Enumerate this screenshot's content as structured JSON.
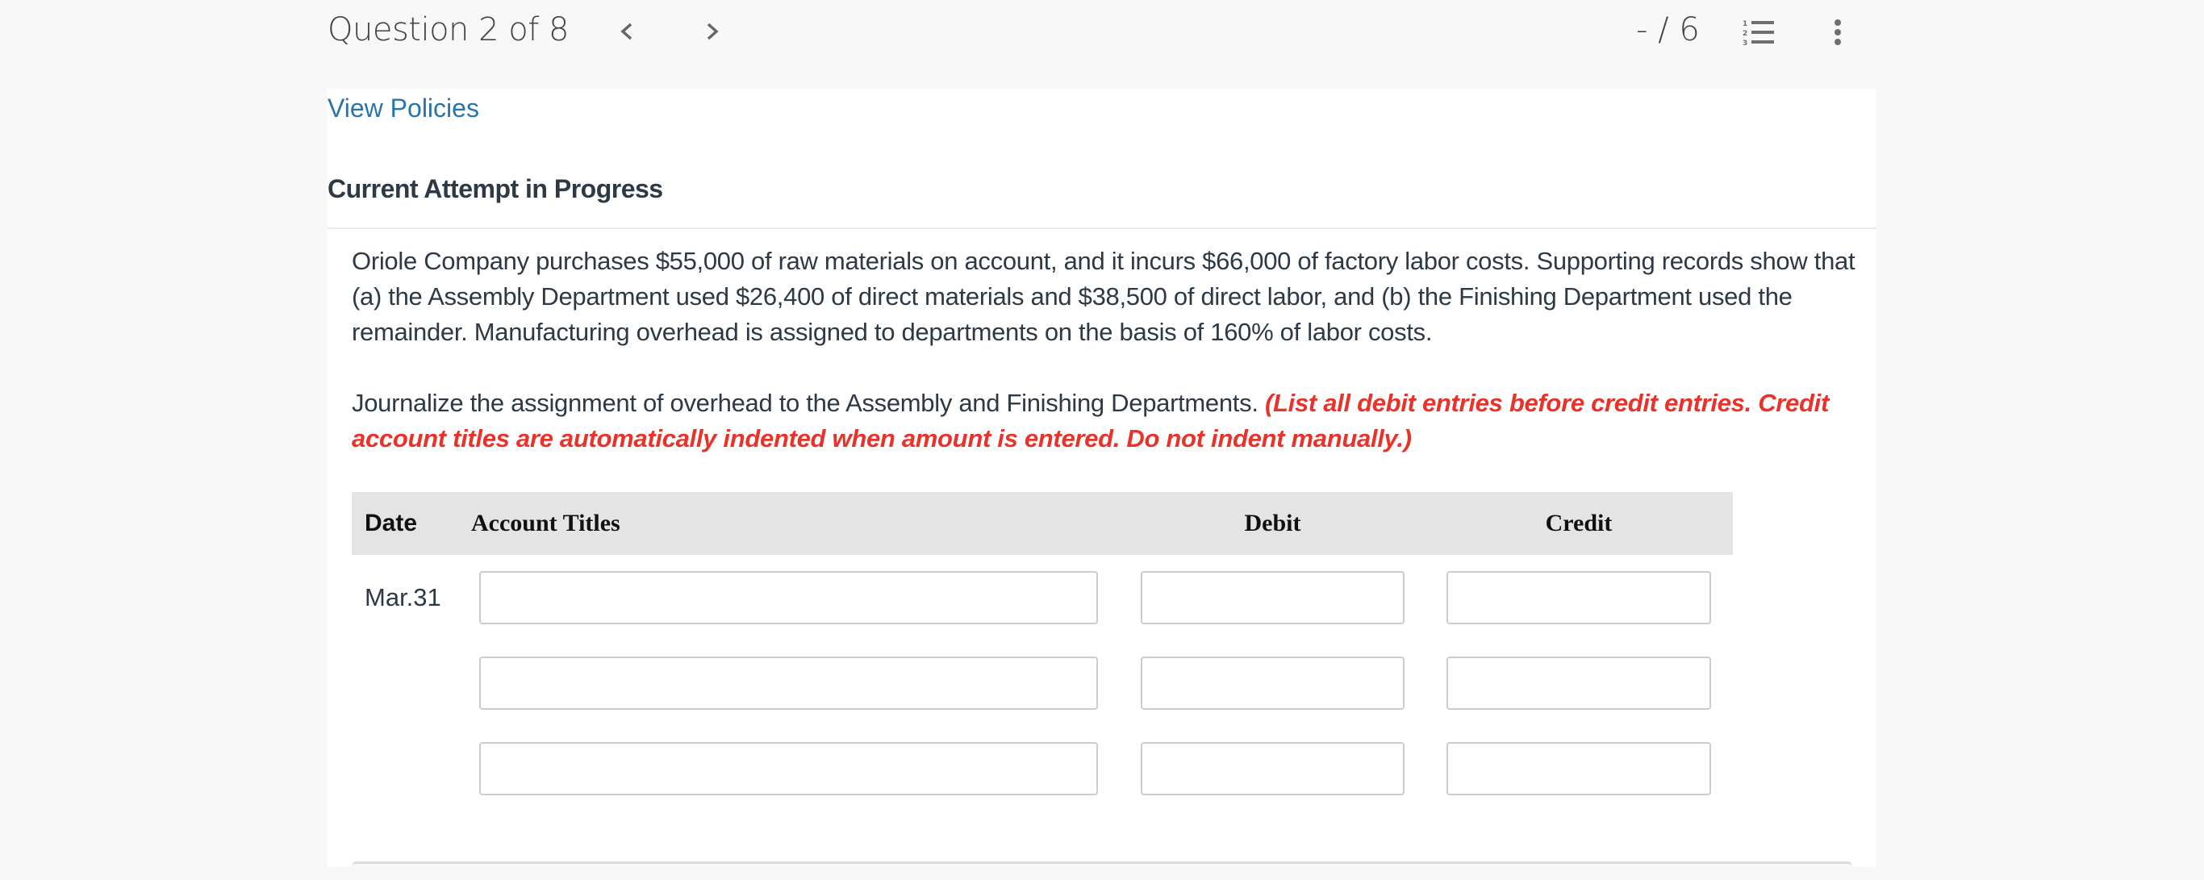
{
  "header": {
    "question_label": "Question 2 of 8",
    "prev_icon": "chevron-left-icon",
    "next_icon": "chevron-right-icon",
    "score": "- / 6",
    "list_icon": "numbered-list-icon",
    "more_icon": "more-vertical-icon"
  },
  "links": {
    "view_policies": "View Policies"
  },
  "attempt_label": "Current Attempt in Progress",
  "question": {
    "text": "Oriole Company purchases $55,000 of raw materials on account, and it incurs $66,000 of factory labor costs. Supporting records show that (a) the Assembly Department used $26,400 of direct materials and $38,500 of direct labor, and (b) the Finishing Department used the remainder. Manufacturing overhead is assigned to departments on the basis of 160% of labor costs.",
    "instruction": "Journalize the assignment of overhead to the Assembly and Finishing Departments.",
    "instruction_note": "(List all debit entries before credit entries. Credit account titles are automatically indented when amount is entered. Do not indent manually.)"
  },
  "journal": {
    "columns": {
      "date": "Date",
      "account": "Account Titles",
      "debit": "Debit",
      "credit": "Credit"
    },
    "rows": [
      {
        "date": "Mar.31",
        "account": "",
        "debit": "",
        "credit": ""
      },
      {
        "date": "",
        "account": "",
        "debit": "",
        "credit": ""
      },
      {
        "date": "",
        "account": "",
        "debit": "",
        "credit": ""
      }
    ]
  },
  "colors": {
    "link": "#2a74ad",
    "note_red": "#e8322a",
    "text": "#2d3944",
    "table_header_bg": "#e4e4e4"
  }
}
